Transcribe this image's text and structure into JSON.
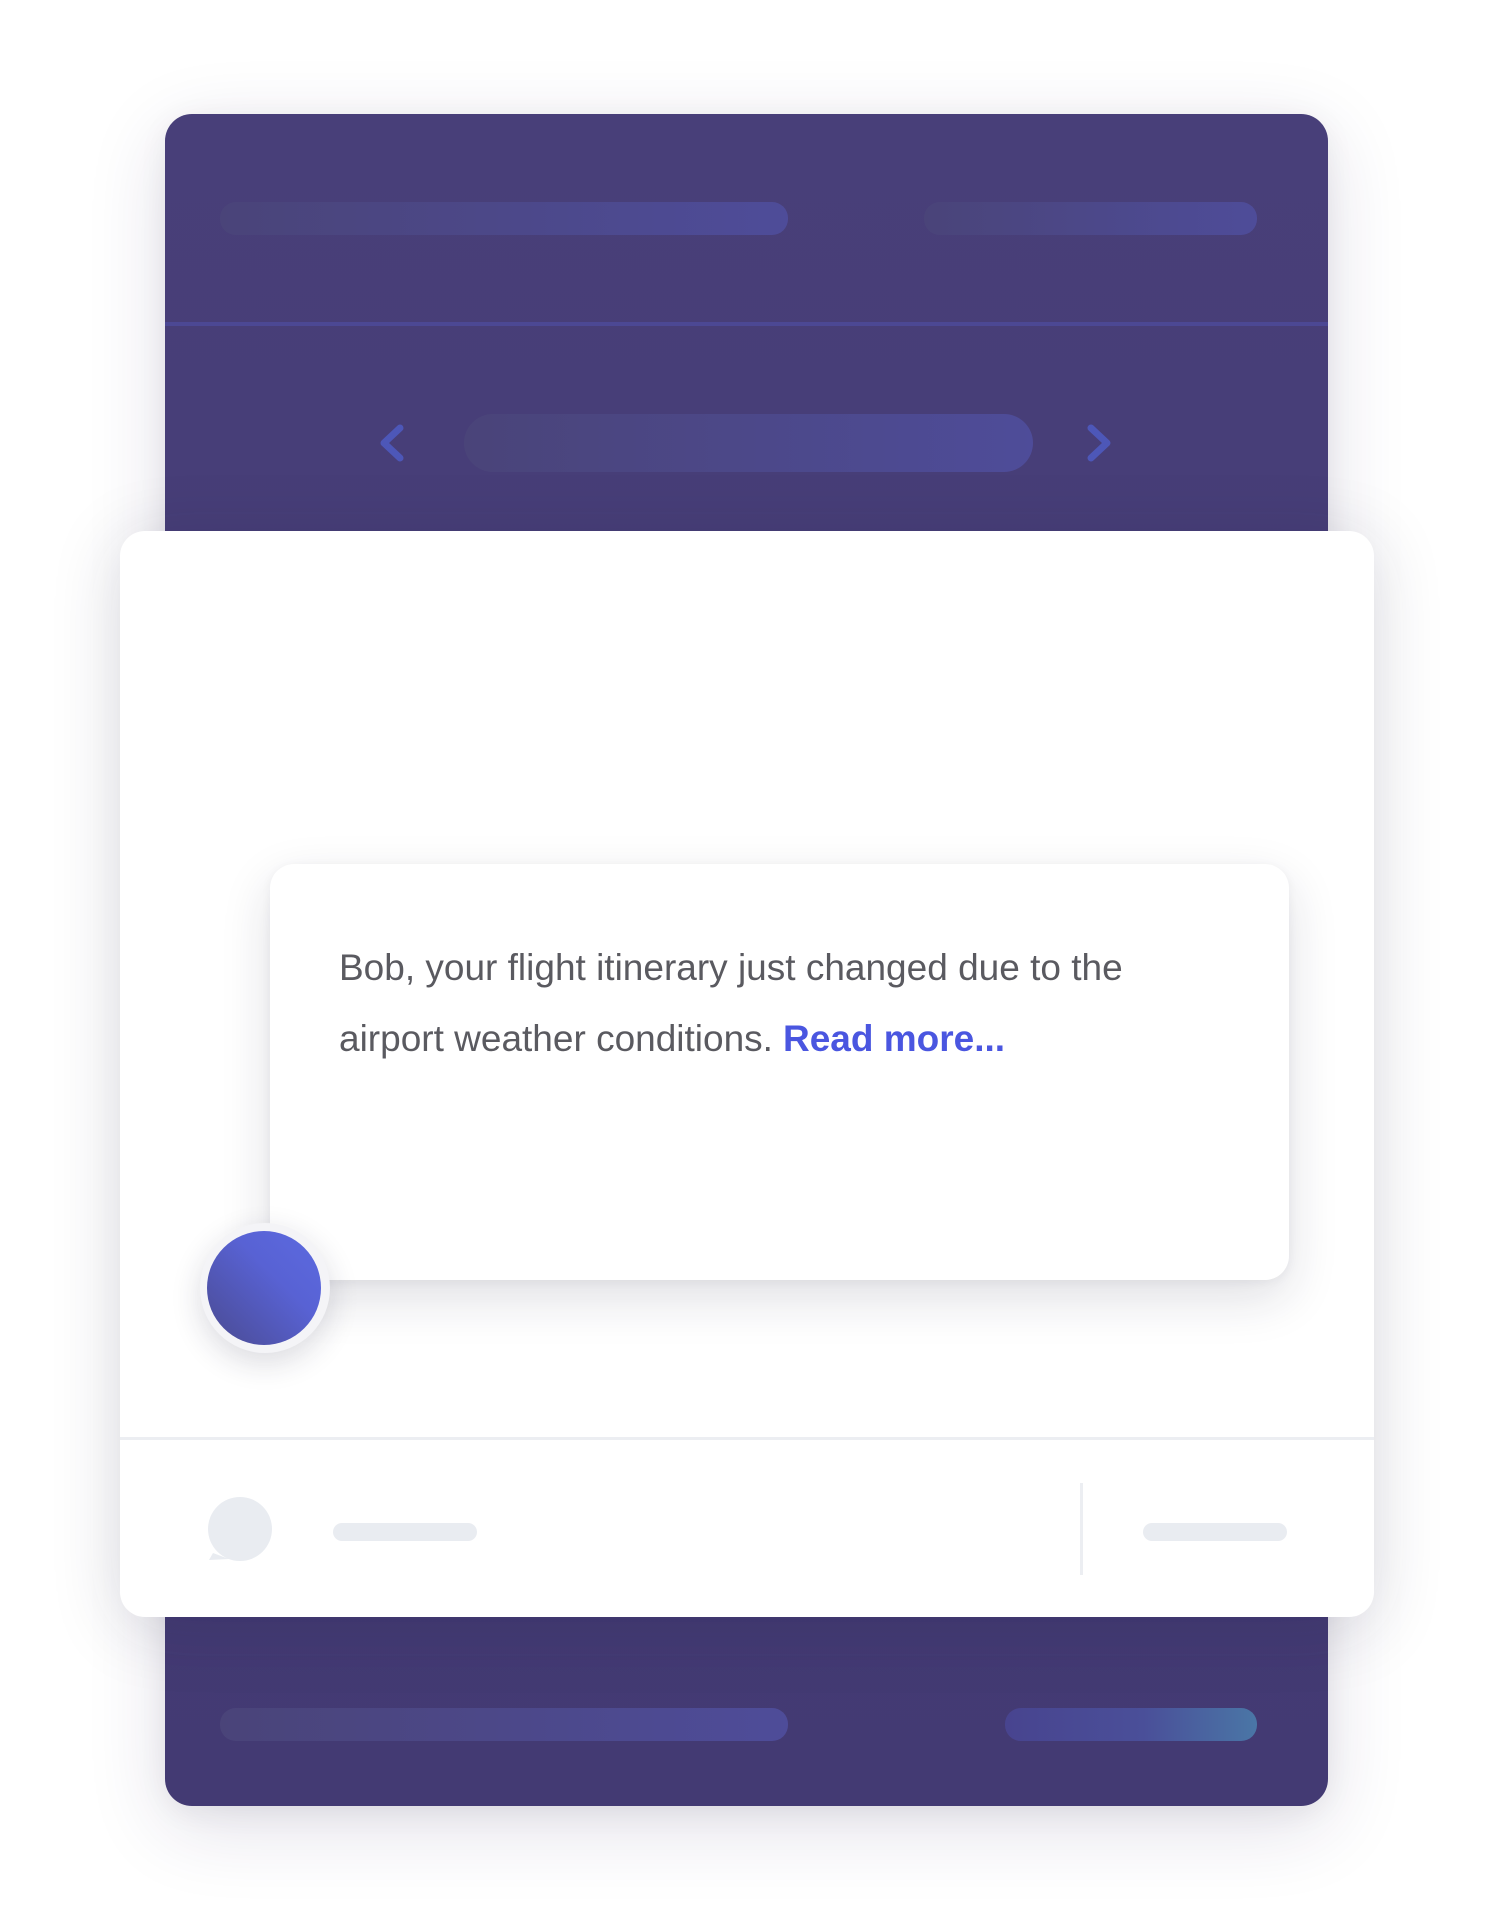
{
  "notification": {
    "message": "Bob, your flight itinerary just changed due to the airport weather conditions.",
    "link_label": "Read more..."
  },
  "icons": {
    "nav_previous": "chevron-left-icon",
    "nav_next": "chevron-right-icon",
    "comment": "comment-bubble-icon",
    "avatar": "user-avatar"
  },
  "colors": {
    "backdrop": "#483f79",
    "link": "#4a56e0",
    "text": "#5a5a60",
    "chevron": "#4d57b8",
    "skeleton_light": "#e9ecf1"
  }
}
